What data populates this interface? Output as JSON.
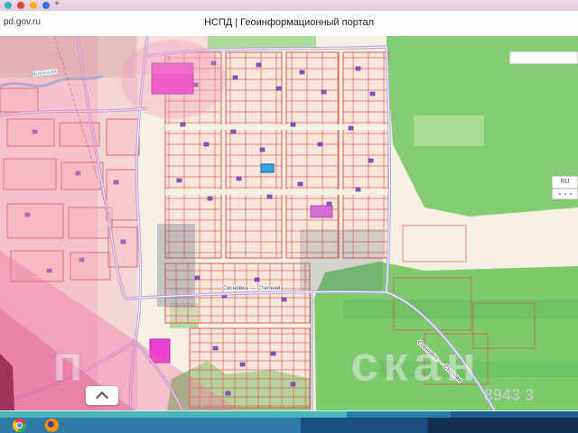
{
  "browser": {
    "tab_icons": [
      "teal-favicon",
      "red-favicon",
      "yellow-favicon",
      "blue-favicon"
    ],
    "new_tab_label": "+",
    "url_text": "pd.gov.ru",
    "page_title": "НСПД | Геоинформационный портал"
  },
  "map": {
    "river_label": "Большая",
    "street_label_horizontal": "Сосновка — Степная",
    "street_label_diagonal": "Сосновка — Степная",
    "watermark_left": "п",
    "watermark_right": "скан",
    "watermark_number": "8943 3",
    "ru_badge": "RU"
  },
  "colors": {
    "forest_green": "#84cc72",
    "zone_pink": "#f07caa",
    "parcel_stroke": "#d95a50",
    "road_violet": "#8d7fd6",
    "selected_parcel_blue": "#35a3dc",
    "building_magenta": "#ea3fd2",
    "taskbar_teal": "#3aacb4",
    "taskbar_navy": "#173f66"
  }
}
